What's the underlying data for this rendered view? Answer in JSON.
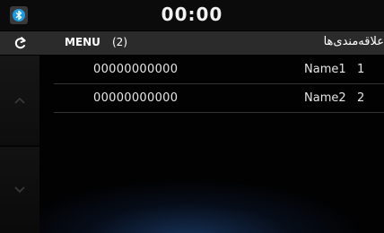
{
  "status_bar": {
    "clock": "00:00",
    "bluetooth_icon": "bluetooth-icon"
  },
  "title_bar": {
    "back_icon": "back-arrow-icon",
    "menu_label": "MENU",
    "menu_count": "(2)",
    "title": "علاقه‌مندی‌ها"
  },
  "scroll": {
    "up_icon": "chevron-up-icon",
    "down_icon": "chevron-down-icon"
  },
  "favorites": [
    {
      "number": "00000000000",
      "name": "Name1",
      "index": "1"
    },
    {
      "number": "00000000000",
      "name": "Name2",
      "index": "2"
    }
  ],
  "colors": {
    "background": "#020203",
    "status_bar": "#0b0b0b",
    "title_bar": "#2b2b2b",
    "bluetooth_box": "#3a3a3a"
  }
}
